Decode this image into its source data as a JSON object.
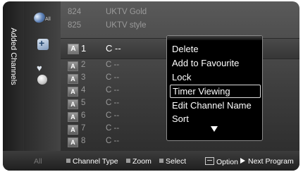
{
  "sidebar": {
    "tab_label": "Added Channels",
    "all_icon_label": "All"
  },
  "channel_list": {
    "top_rows": [
      {
        "number": "824",
        "name": "UKTV Gold"
      },
      {
        "number": "825",
        "name": "UKTV style"
      }
    ],
    "selected": {
      "badge": "A",
      "number": "1",
      "name": "C --"
    },
    "rows": [
      {
        "badge": "A",
        "number": "2",
        "name": "C --"
      },
      {
        "badge": "A",
        "number": "3",
        "name": "C --"
      },
      {
        "badge": "A",
        "number": "4",
        "name": "C --"
      },
      {
        "badge": "A",
        "number": "5",
        "name": "C --"
      },
      {
        "badge": "A",
        "number": "6",
        "name": "C --"
      },
      {
        "badge": "A",
        "number": "7",
        "name": "C --"
      },
      {
        "badge": "A",
        "number": "8",
        "name": "C --"
      }
    ]
  },
  "options_menu": {
    "items": [
      "Delete",
      "Add to Favourite",
      "Lock",
      "Timer Viewing",
      "Edit Channel Name",
      "Sort"
    ],
    "focused_item": "Timer Viewing",
    "more_indicator": "down-arrow"
  },
  "footer": {
    "all_label": "All",
    "channel_type": "Channel Type",
    "zoom": "Zoom",
    "select": "Select",
    "option": "Option",
    "next_program": "Next Program"
  },
  "colors": {
    "panel_bg": "#3c3c3c",
    "menu_bg": "#000000",
    "text_primary": "#ffffff",
    "text_dim": "#9a9a9a"
  }
}
